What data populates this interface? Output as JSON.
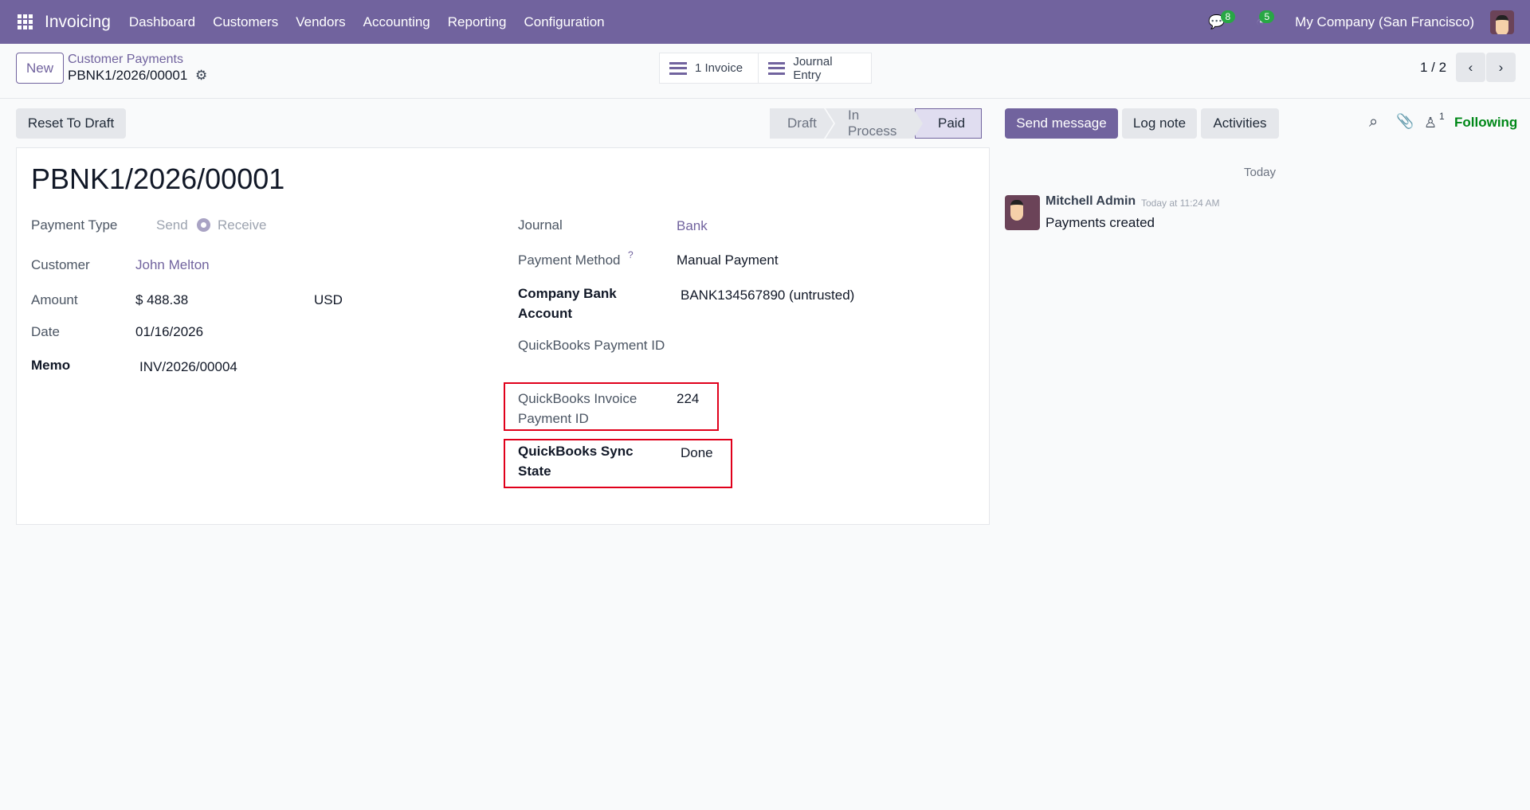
{
  "nav": {
    "app": "Invoicing",
    "menu": [
      "Dashboard",
      "Customers",
      "Vendors",
      "Accounting",
      "Reporting",
      "Configuration"
    ],
    "messages_count": "8",
    "activities_count": "5",
    "company": "My Company (San Francisco)"
  },
  "control": {
    "new_label": "New",
    "breadcrumb_parent": "Customer Payments",
    "breadcrumb_current": "PBNK1/2026/00001",
    "smart_invoice": "1 Invoice",
    "smart_journal": "Journal Entry",
    "pager": "1 / 2"
  },
  "actions": {
    "reset": "Reset To Draft",
    "statuses": [
      "Draft",
      "In Process",
      "Paid"
    ],
    "current_status": "Paid"
  },
  "form": {
    "title": "PBNK1/2026/00001",
    "payment_type_label": "Payment Type",
    "payment_type_send": "Send",
    "payment_type_receive": "Receive",
    "customer_label": "Customer",
    "customer": "John Melton",
    "amount_label": "Amount",
    "amount": "$ 488.38",
    "currency": "USD",
    "date_label": "Date",
    "date": "01/16/2026",
    "memo_label": "Memo",
    "memo": "INV/2026/00004",
    "journal_label": "Journal",
    "journal": "Bank",
    "method_label": "Payment Method",
    "method_help": "?",
    "method": "Manual Payment",
    "bank_label": "Company Bank Account",
    "bank": "BANK134567890 (untrusted)",
    "qb_payment_label": "QuickBooks Payment ID",
    "qb_invoice_payment_label": "QuickBooks Invoice Payment ID",
    "qb_invoice_payment": "224",
    "qb_sync_label": "QuickBooks Sync State",
    "qb_sync": "Done"
  },
  "chatter": {
    "send": "Send message",
    "log": "Log note",
    "activities": "Activities",
    "followers": "1",
    "following": "Following",
    "day": "Today",
    "author": "Mitchell Admin",
    "time": "Today at 11:24 AM",
    "body": "Payments created"
  }
}
